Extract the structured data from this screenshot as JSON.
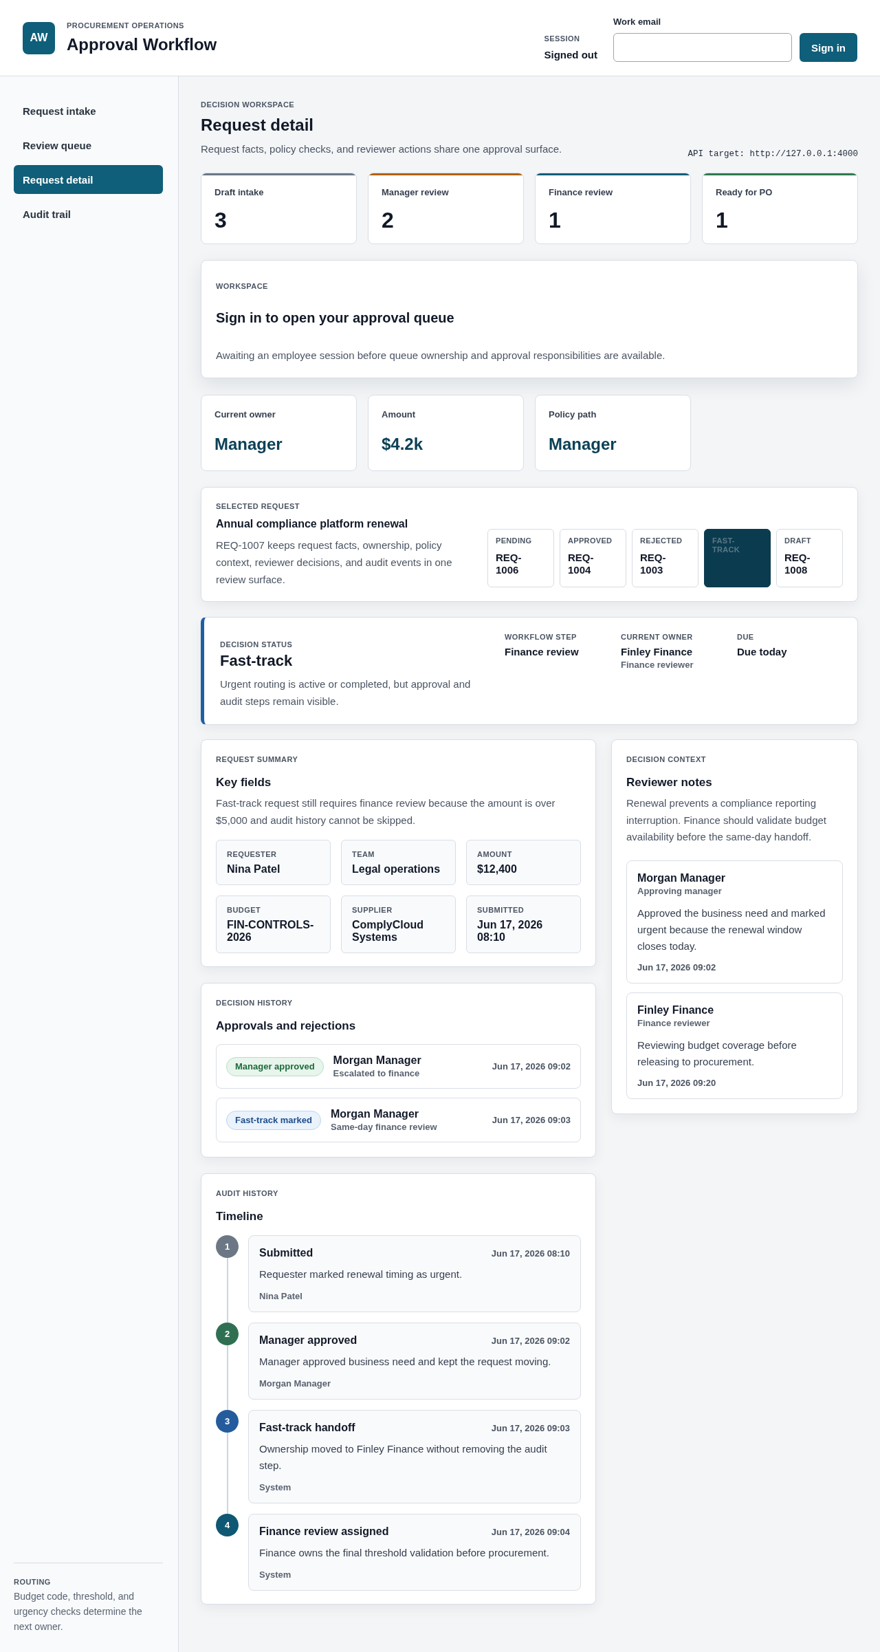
{
  "header": {
    "logo": "AW",
    "eyebrow": "PROCUREMENT OPERATIONS",
    "title": "Approval Workflow",
    "session": {
      "label": "SESSION",
      "value": "Signed out"
    },
    "email_field": {
      "label": "Work email"
    },
    "sign_in_button": "Sign in"
  },
  "sidebar": {
    "items": [
      {
        "label": "Request intake",
        "selected": false
      },
      {
        "label": "Review queue",
        "selected": false
      },
      {
        "label": "Request detail",
        "selected": true
      },
      {
        "label": "Audit trail",
        "selected": false
      }
    ],
    "note": {
      "title": "ROUTING",
      "text": "Budget code, threshold, and urgency checks determine the next owner."
    }
  },
  "page": {
    "eyebrow": "DECISION WORKSPACE",
    "title": "Request detail",
    "subtitle": "Request facts, policy checks, and reviewer actions share one approval surface.",
    "api_target": "API target: http://127.0.0.1:4000"
  },
  "stages": [
    {
      "label": "Draft intake",
      "count": "3",
      "color": "#6b7785"
    },
    {
      "label": "Manager review",
      "count": "2",
      "color": "#b0620f"
    },
    {
      "label": "Finance review",
      "count": "1",
      "color": "#0f5e7a"
    },
    {
      "label": "Ready for PO",
      "count": "1",
      "color": "#2f7a4f"
    }
  ],
  "workspace": {
    "eyebrow": "WORKSPACE",
    "title": "Sign in to open your approval queue",
    "text": "Awaiting an employee session before queue ownership and approval responsibilities are available."
  },
  "metrics": [
    {
      "label": "Current owner",
      "value": "Manager"
    },
    {
      "label": "Amount",
      "value": "$4.2k"
    },
    {
      "label": "Policy path",
      "value": "Manager"
    }
  ],
  "selected_request": {
    "eyebrow": "SELECTED REQUEST",
    "title": "Annual compliance platform renewal",
    "text": "REQ-1007 keeps request facts, ownership, policy context, reviewer decisions, and audit events in one review surface.",
    "queue": [
      {
        "status": "PENDING",
        "id": "REQ-1006",
        "selected": false
      },
      {
        "status": "APPROVED",
        "id": "REQ-1004",
        "selected": false
      },
      {
        "status": "REJECTED",
        "id": "REQ-1003",
        "selected": false
      },
      {
        "status": "FAST-TRACK",
        "selected": true
      },
      {
        "status": "DRAFT",
        "id": "REQ-1008",
        "selected": false
      }
    ]
  },
  "decision_status": {
    "eyebrow": "DECISION STATUS",
    "title": "Fast-track",
    "text": "Urgent routing is active or completed, but approval and audit steps remain visible.",
    "meta": [
      {
        "label": "WORKFLOW STEP",
        "value": "Finance review"
      },
      {
        "label": "CURRENT OWNER",
        "value": "Finley Finance",
        "detail": "Finance reviewer"
      },
      {
        "label": "DUE",
        "value": "Due today"
      }
    ]
  },
  "request_summary": {
    "eyebrow": "REQUEST SUMMARY",
    "title": "Key fields",
    "text": "Fast-track request still requires finance review because the amount is over $5,000 and audit history cannot be skipped.",
    "fields": [
      {
        "label": "REQUESTER",
        "value": "Nina Patel"
      },
      {
        "label": "TEAM",
        "value": "Legal operations"
      },
      {
        "label": "AMOUNT",
        "value": "$12,400"
      },
      {
        "label": "BUDGET",
        "value": "FIN-CONTROLS-2026"
      },
      {
        "label": "SUPPLIER",
        "value": "ComplyCloud Systems"
      },
      {
        "label": "SUBMITTED",
        "value": "Jun 17, 2026 08:10"
      }
    ]
  },
  "decision_history": {
    "eyebrow": "DECISION HISTORY",
    "title": "Approvals and rejections",
    "entries": [
      {
        "kind": "approved",
        "badge": "Manager approved",
        "actor": "Morgan Manager",
        "note": "Escalated to finance",
        "time": "Jun 17, 2026 09:02"
      },
      {
        "kind": "flagged",
        "badge": "Fast-track marked",
        "actor": "Morgan Manager",
        "note": "Same-day finance review",
        "time": "Jun 17, 2026 09:03"
      }
    ]
  },
  "audit_history": {
    "eyebrow": "AUDIT HISTORY",
    "title": "Timeline",
    "events": [
      {
        "step": "1",
        "color": "#6b7785",
        "title": "Submitted",
        "time": "Jun 17, 2026 08:10",
        "text": "Requester marked renewal timing as urgent.",
        "actor": "Nina Patel"
      },
      {
        "step": "2",
        "color": "#2f7052",
        "title": "Manager approved",
        "time": "Jun 17, 2026 09:02",
        "text": "Manager approved business need and kept the request moving.",
        "actor": "Morgan Manager"
      },
      {
        "step": "3",
        "color": "#245b9d",
        "title": "Fast-track handoff",
        "time": "Jun 17, 2026 09:03",
        "text": "Ownership moved to Finley Finance without removing the audit step.",
        "actor": "System"
      },
      {
        "step": "4",
        "color": "#0f5873",
        "title": "Finance review assigned",
        "time": "Jun 17, 2026 09:04",
        "text": "Finance owns the final threshold validation before procurement.",
        "actor": "System"
      }
    ]
  },
  "decision_context": {
    "eyebrow": "DECISION CONTEXT",
    "title": "Reviewer notes",
    "text": "Renewal prevents a compliance reporting interruption. Finance should validate budget availability before the same-day handoff.",
    "notes": [
      {
        "author": "Morgan Manager",
        "role": "Approving manager",
        "text": "Approved the business need and marked urgent because the renewal window closes today.",
        "time": "Jun 17, 2026 09:02"
      },
      {
        "author": "Finley Finance",
        "role": "Finance reviewer",
        "text": "Reviewing budget coverage before releasing to procurement.",
        "time": "Jun 17, 2026 09:20"
      }
    ]
  }
}
